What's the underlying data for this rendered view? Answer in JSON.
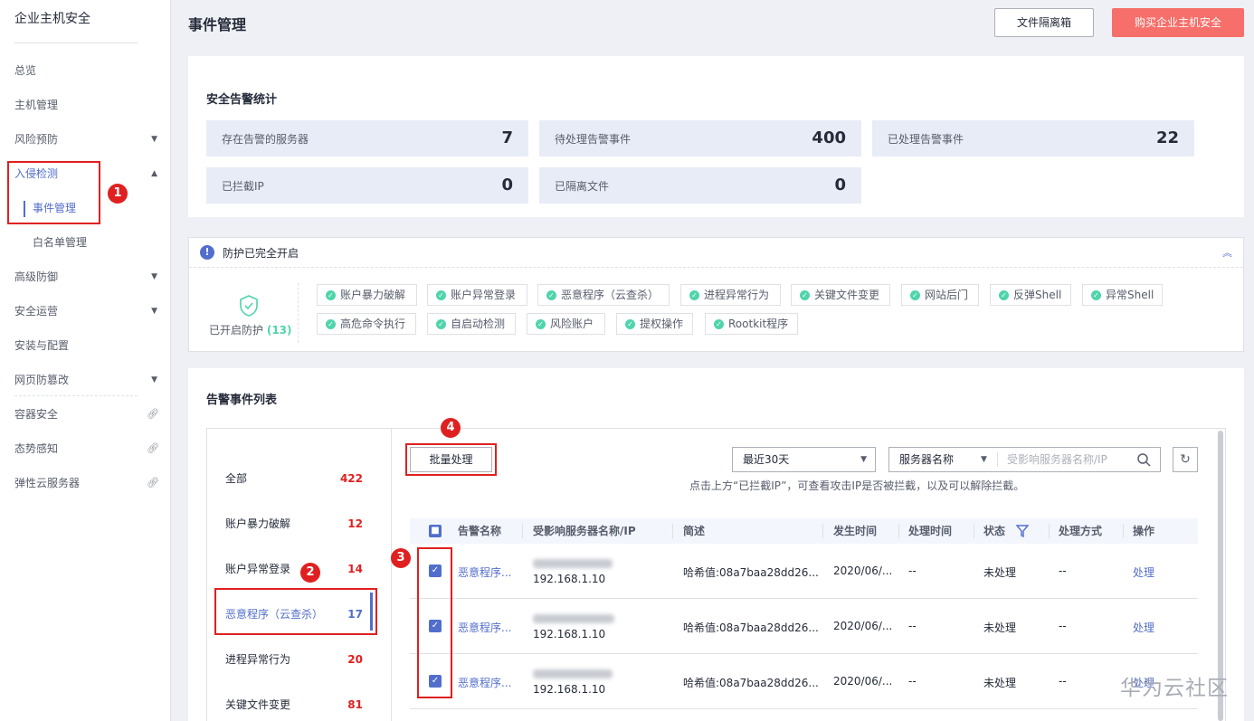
{
  "sidebar": {
    "title": "企业主机安全",
    "items": [
      {
        "label": "总览"
      },
      {
        "label": "主机管理"
      },
      {
        "label": "风险预防"
      },
      {
        "label": "入侵检测"
      },
      {
        "label": "事件管理"
      },
      {
        "label": "白名单管理"
      },
      {
        "label": "高级防御"
      },
      {
        "label": "安全运营"
      },
      {
        "label": "安装与配置"
      },
      {
        "label": "网页防篡改"
      },
      {
        "label": "容器安全"
      },
      {
        "label": "态势感知"
      },
      {
        "label": "弹性云服务器"
      }
    ]
  },
  "header": {
    "title": "事件管理",
    "btn_isolation": "文件隔离箱",
    "btn_buy": "购买企业主机安全"
  },
  "stats": {
    "title": "安全告警统计",
    "items": [
      {
        "label": "存在告警的服务器",
        "value": "7"
      },
      {
        "label": "待处理告警事件",
        "value": "400"
      },
      {
        "label": "已处理告警事件",
        "value": "22"
      },
      {
        "label": "已拦截IP",
        "value": "0"
      },
      {
        "label": "已隔离文件",
        "value": "0"
      }
    ]
  },
  "protection": {
    "header": "防护已完全开启",
    "enabled_label": "已开启防护",
    "enabled_count": "(13)",
    "tags": [
      "账户暴力破解",
      "账户异常登录",
      "恶意程序（云查杀）",
      "进程异常行为",
      "关键文件变更",
      "网站后门",
      "反弹Shell",
      "异常Shell",
      "高危命令执行",
      "自启动检测",
      "风险账户",
      "提权操作",
      "Rootkit程序"
    ]
  },
  "list": {
    "title": "告警事件列表",
    "categories": [
      {
        "label": "全部",
        "count": "422"
      },
      {
        "label": "账户暴力破解",
        "count": "12"
      },
      {
        "label": "账户异常登录",
        "count": "14"
      },
      {
        "label": "恶意程序（云查杀）",
        "count": "17"
      },
      {
        "label": "进程异常行为",
        "count": "20"
      },
      {
        "label": "关键文件变更",
        "count": "81"
      }
    ],
    "batch_button": "批量处理",
    "period": "最近30天",
    "search_field": "服务器名称",
    "search_placeholder": "受影响服务器名称/IP",
    "note": "点击上方“已拦截IP”，可查看攻击IP是否被拦截，以及可以解除拦截。",
    "columns": [
      "告警名称",
      "受影响服务器名称/IP",
      "简述",
      "发生时间",
      "处理时间",
      "状态",
      "处理方式",
      "操作"
    ],
    "rows": [
      {
        "name": "恶意程序...",
        "ip": "192.168.1.10",
        "summary": "哈希值:08a7baa28dd26...",
        "time": "2020/06/...",
        "handle_time": "--",
        "status": "未处理",
        "method": "--",
        "action": "处理"
      },
      {
        "name": "恶意程序...",
        "ip": "192.168.1.10",
        "summary": "哈希值:08a7baa28dd26...",
        "time": "2020/06/...",
        "handle_time": "--",
        "status": "未处理",
        "method": "--",
        "action": "处理"
      },
      {
        "name": "恶意程序...",
        "ip": "192.168.1.10",
        "summary": "哈希值:08a7baa28dd26...",
        "time": "2020/06/...",
        "handle_time": "--",
        "status": "未处理",
        "method": "--",
        "action": "处理"
      }
    ]
  },
  "annotations": [
    "1",
    "2",
    "3",
    "4"
  ],
  "watermark": "华为云社区",
  "colors": {
    "accent": "#526ecc",
    "buy": "#f66f6a",
    "alert": "#e02020",
    "ok": "#50d4ab"
  }
}
